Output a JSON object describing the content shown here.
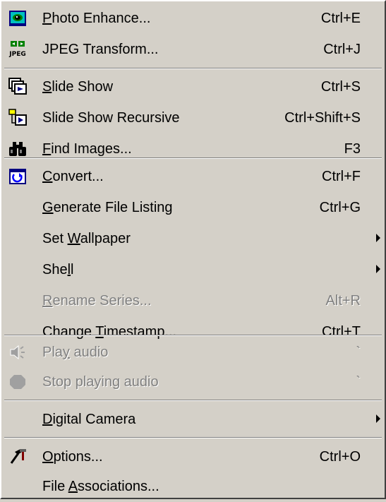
{
  "menu": {
    "photo_enhance": {
      "pre": "",
      "key": "P",
      "post": "hoto Enhance...",
      "shortcut": "Ctrl+E",
      "icon": "photo-enhance-icon"
    },
    "jpeg_transform": {
      "pre": "JPEG Transform...",
      "key": "",
      "post": "",
      "shortcut": "Ctrl+J",
      "icon": "jpeg-transform-icon",
      "icon_text": "JPEG"
    },
    "slide_show": {
      "pre": "",
      "key": "S",
      "post": "lide Show",
      "shortcut": "Ctrl+S",
      "icon": "slide-show-icon"
    },
    "slide_show_recursive": {
      "pre": "Slide Show Recursive",
      "key": "",
      "post": "",
      "shortcut": "Ctrl+Shift+S",
      "icon": "slide-show-recursive-icon"
    },
    "find_images": {
      "pre": "",
      "key": "F",
      "post": "ind Images...",
      "shortcut": "F3",
      "icon": "binoculars-icon"
    },
    "convert": {
      "pre": "",
      "key": "C",
      "post": "onvert...",
      "shortcut": "Ctrl+F",
      "icon": "convert-icon"
    },
    "generate_file_listing": {
      "pre": "",
      "key": "G",
      "post": "enerate File Listing",
      "shortcut": "Ctrl+G"
    },
    "set_wallpaper": {
      "pre": "Set ",
      "key": "W",
      "post": "allpaper",
      "shortcut": ""
    },
    "shell": {
      "pre": "She",
      "key": "l",
      "post": "l",
      "shortcut": ""
    },
    "rename_series": {
      "pre": "",
      "key": "R",
      "post": "ename Series...",
      "shortcut": "Alt+R",
      "enabled": false
    },
    "change_timestamp": {
      "pre": "Change ",
      "key": "T",
      "post": "imestamp...",
      "shortcut": "Ctrl+T"
    },
    "play_audio": {
      "pre": "Pla",
      "key": "y",
      "post": " audio",
      "shortcut": "`",
      "icon": "speaker-icon",
      "enabled": false
    },
    "stop_playing_audio": {
      "pre": "Stop playing audio",
      "key": "",
      "post": "",
      "shortcut": "`",
      "icon": "stop-icon",
      "enabled": false
    },
    "digital_camera": {
      "pre": "",
      "key": "D",
      "post": "igital Camera",
      "shortcut": ""
    },
    "options": {
      "pre": "",
      "key": "O",
      "post": "ptions...",
      "shortcut": "Ctrl+O",
      "icon": "tools-icon"
    },
    "file_associations": {
      "pre": "File ",
      "key": "A",
      "post": "ssociations...",
      "shortcut": ""
    }
  },
  "colors": {
    "menu_background": "#d4d0c8",
    "disabled_text": "#808080",
    "highlight_light": "#ffffff",
    "shadow": "#808080"
  }
}
